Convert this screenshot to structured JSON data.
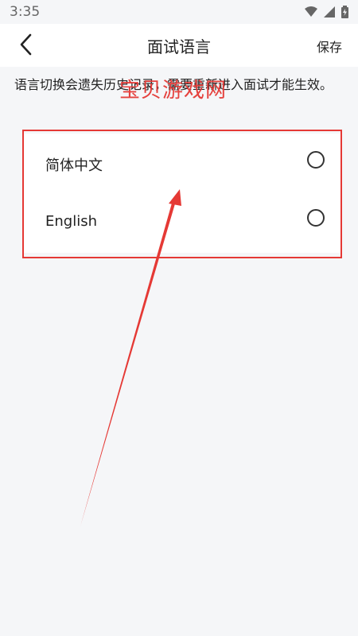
{
  "status_bar": {
    "time": "3:35"
  },
  "nav": {
    "title": "面试语言",
    "save_label": "保存"
  },
  "notice": "语言切换会遗失历史记录，需要重新进入面试才能生效。",
  "languages": [
    {
      "label": "简体中文",
      "selected": false
    },
    {
      "label": "English",
      "selected": false
    }
  ],
  "watermark": "宝贝游戏网",
  "colors": {
    "accent_red": "#e53935",
    "background": "#f5f6f8"
  },
  "icons": [
    "wifi-icon",
    "signal-icon",
    "battery-icon",
    "back-arrow-icon"
  ]
}
